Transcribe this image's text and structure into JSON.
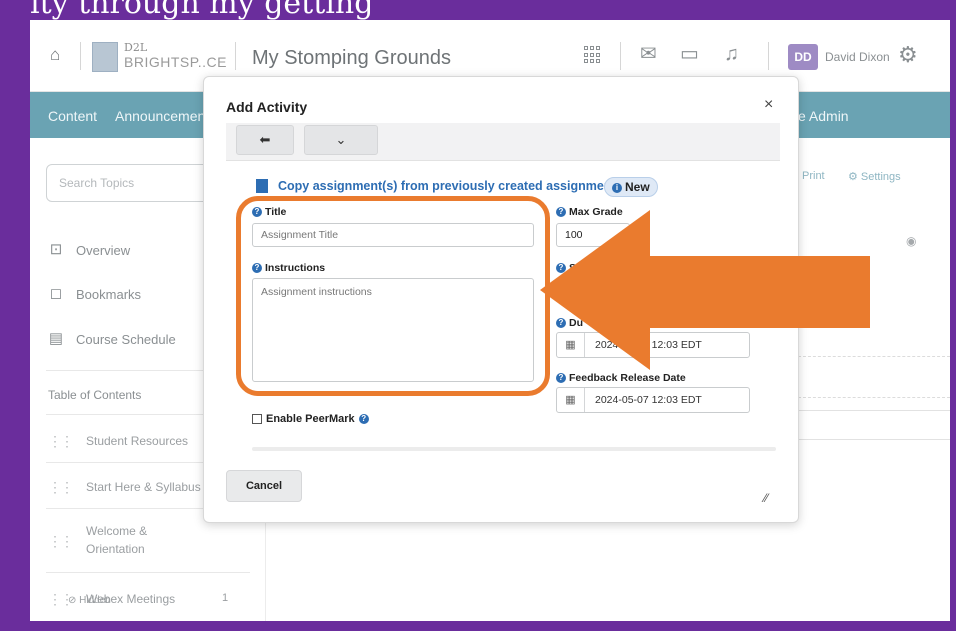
{
  "caption": "ity through my getting",
  "header": {
    "logo_top": "D2L",
    "logo_bottom": "BRIGHTSP..CE",
    "course_title": "My Stomping Grounds",
    "user_initials": "DD",
    "user_name": "David Dixon"
  },
  "navbar": {
    "items": [
      "Content",
      "Announcemen"
    ],
    "right_item": "e Admin"
  },
  "sidebar": {
    "search_placeholder": "Search Topics",
    "items": [
      {
        "label": "Overview",
        "icon": "presentation-icon"
      },
      {
        "label": "Bookmarks",
        "icon": "bookmark-icon"
      },
      {
        "label": "Course Schedule",
        "icon": "calendar-icon"
      }
    ],
    "toc_heading": "Table of Contents",
    "modules": [
      {
        "label": "Student Resources"
      },
      {
        "label": "Start Here & Syllabus"
      },
      {
        "label": "Welcome &\nOrientation"
      },
      {
        "label": "Webex Meetings",
        "count": "1",
        "status": "Hidden"
      }
    ]
  },
  "content": {
    "print_label": "Print",
    "settings_label": "Settings"
  },
  "dialog": {
    "title": "Add Activity",
    "close_glyph": "×",
    "copy_link": "Copy assignment(s) from previously created assignments",
    "new_badge": "New",
    "title_label": "Title",
    "title_placeholder": "Assignment Title",
    "instructions_label": "Instructions",
    "instructions_placeholder": "Assignment instructions",
    "max_grade_label": "Max Grade",
    "max_grade_value": "100",
    "start_label_partial": "St",
    "due_label_partial": "Du",
    "due_date": "2024-05-07 12:03 EDT",
    "feedback_label": "Feedback Release Date",
    "feedback_date": "2024-05-07 12:03 EDT",
    "peermark_label": "Enable PeerMark",
    "cancel_label": "Cancel"
  },
  "annotation": {
    "highlight_color": "#ea7b2e",
    "arrow_color": "#ea7b2e"
  }
}
